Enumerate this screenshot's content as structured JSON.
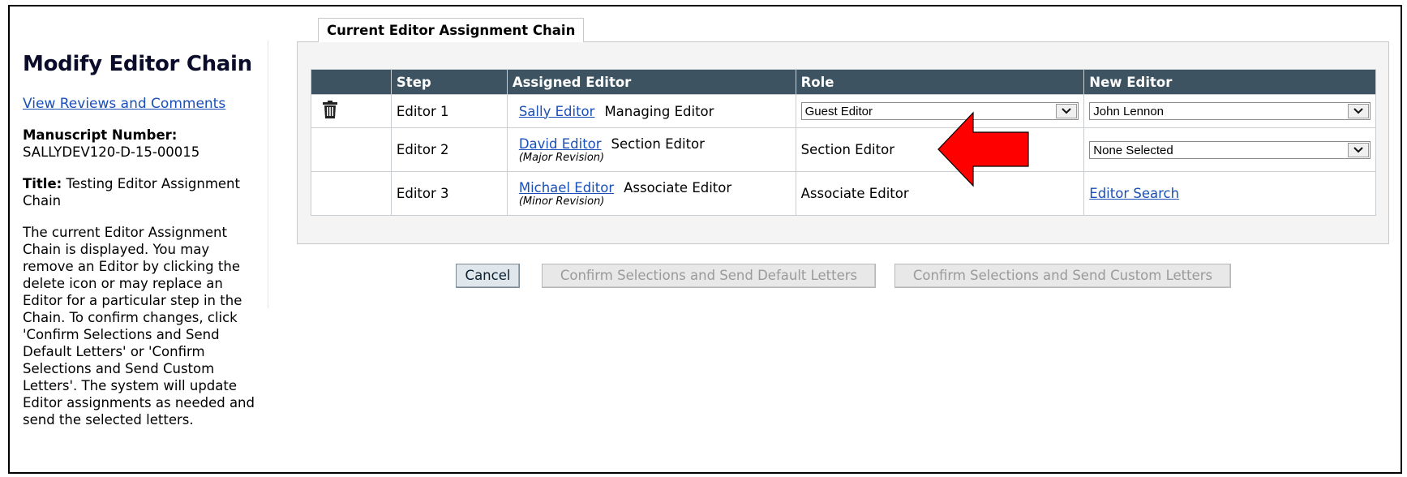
{
  "page": {
    "title": "Modify Editor Chain",
    "view_reviews_link": "View Reviews and Comments",
    "manuscript_label": "Manuscript Number:",
    "manuscript_number": "SALLYDEV120-D-15-00015",
    "title_label": "Title:",
    "title_value": "Testing Editor Assignment Chain",
    "description": "The current Editor Assignment Chain is displayed. You may remove an Editor by clicking the delete icon or may replace an Editor for a particular step in the Chain. To confirm changes, click 'Confirm Selections and Send Default Letters' or 'Confirm Selections and Send Custom Letters'. The system will update Editor assignments as needed and send the selected letters."
  },
  "tab": {
    "label": "Current Editor Assignment Chain"
  },
  "table": {
    "headers": [
      "",
      "Step",
      "Assigned Editor",
      "Role",
      "New Editor"
    ],
    "rows": [
      {
        "step": "Editor 1",
        "editor_name": "Sally Editor",
        "editor_role": "Managing Editor",
        "revision": "",
        "role_select": "Guest Editor",
        "new_editor_select": "John Lennon",
        "has_delete": true
      },
      {
        "step": "Editor 2",
        "editor_name": "David Editor",
        "editor_role": "Section Editor",
        "revision": "(Major Revision)",
        "role": "Section Editor",
        "new_editor_select": "None Selected",
        "has_delete": false
      },
      {
        "step": "Editor 3",
        "editor_name": "Michael Editor",
        "editor_role": "Associate Editor",
        "revision": "(Minor Revision)",
        "role": "Associate Editor",
        "new_editor_link": "Editor Search",
        "has_delete": false
      }
    ]
  },
  "buttons": {
    "cancel": "Cancel",
    "default_letters": "Confirm Selections and Send Default Letters",
    "custom_letters": "Confirm Selections and Send Custom Letters"
  },
  "colors": {
    "header_bg": "#3d5361",
    "link": "#1a4fb8",
    "arrow": "#ff0000"
  },
  "icons": {
    "delete": "trash-icon",
    "dropdown": "chevron-down-icon",
    "annotation": "red-arrow-icon"
  }
}
